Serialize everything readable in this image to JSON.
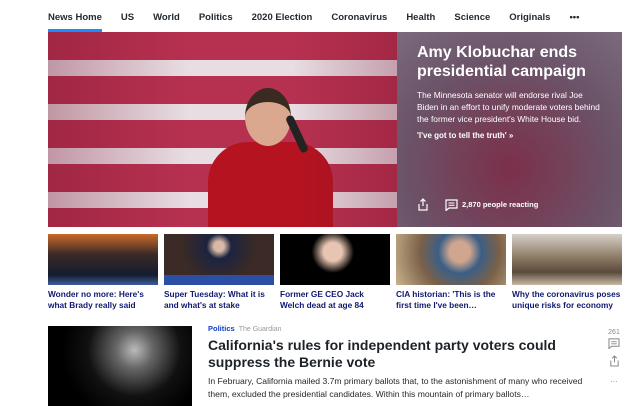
{
  "nav": {
    "items": [
      "News Home",
      "US",
      "World",
      "Politics",
      "2020 Election",
      "Coronavirus",
      "Health",
      "Science",
      "Originals"
    ],
    "more_icon": "ellipsis-icon",
    "accent": "#188fff"
  },
  "hero": {
    "title": "Amy Klobuchar ends presidential campaign",
    "summary": "The Minnesota senator will endorse rival Joe Biden in an effort to unify moderate voters behind the former vice president's White House bid.",
    "link": "'I've got to tell the truth' »",
    "reactions": "2,870 people reacting"
  },
  "thumbs": [
    {
      "caption": "Wonder no more: Here's what Brady really said"
    },
    {
      "caption": "Super Tuesday: What it is and what's at stake"
    },
    {
      "caption": "Former GE CEO Jack Welch dead at age 84"
    },
    {
      "caption": "CIA historian: 'This is the first time I've been…"
    },
    {
      "caption": "Why the coronavirus poses unique risks for economy"
    }
  ],
  "article": {
    "category": "Politics",
    "source": "The Guardian",
    "title": "California's rules for independent party voters could suppress the Bernie vote",
    "summary": "In February, California mailed 3.7m primary ballots that, to the astonishment of many who received them, excluded the presidential candidates. Within this mountain of primary ballots…",
    "comments": "261"
  }
}
